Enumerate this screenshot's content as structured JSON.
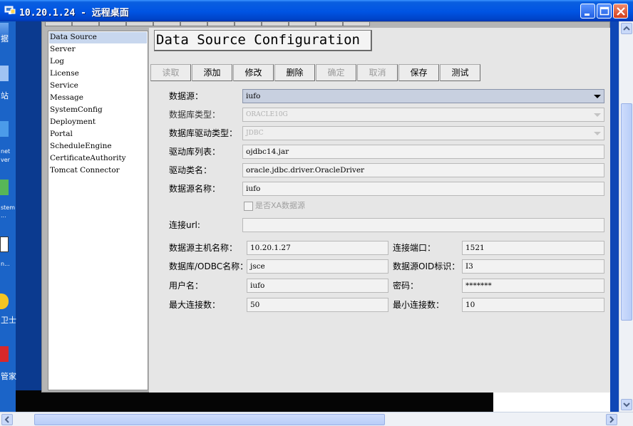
{
  "window": {
    "title": "10.20.1.24 - 远程桌面"
  },
  "desktop": {
    "labels": [
      "据",
      "站",
      "net",
      "ver",
      "stem",
      "...",
      "n...",
      "卫士",
      "管家"
    ]
  },
  "nav": {
    "items": [
      {
        "label": "Data Source",
        "selected": true
      },
      {
        "label": "Server"
      },
      {
        "label": "Log"
      },
      {
        "label": "License"
      },
      {
        "label": "Service"
      },
      {
        "label": "Message"
      },
      {
        "label": "SystemConfig"
      },
      {
        "label": "Deployment"
      },
      {
        "label": "Portal"
      },
      {
        "label": "ScheduleEngine"
      },
      {
        "label": "CertificateAuthority"
      },
      {
        "label": "Tomcat Connector"
      }
    ]
  },
  "panel": {
    "title": "Data Source Configuration"
  },
  "toolbar": {
    "buttons": [
      {
        "label": "读取",
        "enabled": false
      },
      {
        "label": "添加",
        "enabled": true
      },
      {
        "label": "修改",
        "enabled": true
      },
      {
        "label": "删除",
        "enabled": true
      },
      {
        "label": "确定",
        "enabled": false
      },
      {
        "label": "取消",
        "enabled": false
      },
      {
        "label": "保存",
        "enabled": true
      },
      {
        "label": "测试",
        "enabled": true
      }
    ]
  },
  "form": {
    "datasource": {
      "label": "数据源：",
      "value": "iufo"
    },
    "db_type": {
      "label": "数据库类型：",
      "value": "ORACLE10G"
    },
    "driver_type": {
      "label": "数据库驱动类型：",
      "value": "JDBC"
    },
    "driver_list": {
      "label": "驱动库列表：",
      "value": "ojdbc14.jar"
    },
    "driver_class": {
      "label": "驱动类名：",
      "value": "oracle.jdbc.driver.OracleDriver"
    },
    "ds_name": {
      "label": "数据源名称：",
      "value": "iufo"
    },
    "xa": {
      "label": "是否XA数据源",
      "checked": false
    },
    "url": {
      "label": "连接url:",
      "value": ""
    },
    "host": {
      "label": "数据源主机名称：",
      "value": "10.20.1.27"
    },
    "port": {
      "label": "连接端口：",
      "value": "1521"
    },
    "db_name": {
      "label": "数据库/ODBC名称：",
      "value": "jsce"
    },
    "oid": {
      "label": "数据源OID标识：",
      "value": "I3"
    },
    "user": {
      "label": "用户名：",
      "value": "iufo"
    },
    "password": {
      "label": "密码：",
      "value": "*******"
    },
    "max_conn": {
      "label": "最大连接数：",
      "value": "50"
    },
    "min_conn": {
      "label": "最小连接数：",
      "value": "10"
    }
  }
}
